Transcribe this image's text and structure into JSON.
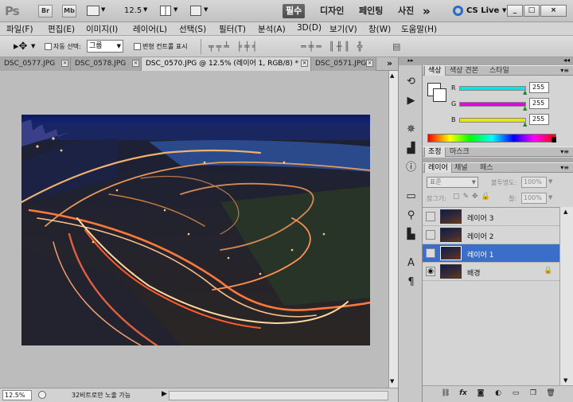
{
  "app": {
    "logo": "Ps"
  },
  "title_bar": {
    "br_label": "Br",
    "mb_label": "Mb",
    "zoom": "12.5",
    "workspaces": [
      "필수",
      "디자인",
      "페인팅",
      "사진"
    ],
    "overflow": "»",
    "cslive": "CS Live",
    "window_buttons": [
      "_",
      "□",
      "×"
    ]
  },
  "menu": [
    "파일(F)",
    "편집(E)",
    "이미지(I)",
    "레이어(L)",
    "선택(S)",
    "필터(T)",
    "분석(A)",
    "3D(D)",
    "보기(V)",
    "창(W)",
    "도움말(H)"
  ],
  "options_bar": {
    "auto_select_label": "자동 선택:",
    "auto_select_value": "그룹",
    "transform_label": "변형 컨트롤 표시"
  },
  "tabs": [
    {
      "label": "DSC_0577.JPG",
      "active": false
    },
    {
      "label": "DSC_0578.JPG",
      "active": false
    },
    {
      "label": "DSC_0570.JPG @ 12.5% (레이어 1, RGB/8) *",
      "active": true
    },
    {
      "label": "DSC_0571.JPG",
      "active": false
    }
  ],
  "tab_overflow": "»",
  "status": {
    "zoom": "12.5%",
    "info": "32비트로만 노출 가능"
  },
  "color_panel": {
    "tabs": [
      "색상",
      "색상 견본",
      "스타일"
    ],
    "channels": [
      {
        "label": "R",
        "value": "255",
        "color": "#00e5e5"
      },
      {
        "label": "G",
        "value": "255",
        "color": "#e500e5"
      },
      {
        "label": "B",
        "value": "255",
        "color": "#e5e500"
      }
    ]
  },
  "adjust_panel": {
    "tabs": [
      "조정",
      "마스크"
    ]
  },
  "layers_panel": {
    "tabs": [
      "레이어",
      "채널",
      "패스"
    ],
    "blend_mode": "표준",
    "opacity_label": "불투명도:",
    "opacity_value": "100%",
    "lock_label": "잠그기:",
    "fill_label": "칠:",
    "fill_value": "100%",
    "layers": [
      {
        "name": "레이어 3",
        "visible": false,
        "selected": false,
        "locked": false
      },
      {
        "name": "레이어 2",
        "visible": false,
        "selected": false,
        "locked": false
      },
      {
        "name": "레이어 1",
        "visible": false,
        "selected": true,
        "locked": false
      },
      {
        "name": "배경",
        "visible": true,
        "selected": false,
        "locked": true
      }
    ],
    "footer_icons": [
      "link-icon",
      "fx-icon",
      "mask-icon",
      "adjustment-icon",
      "group-icon",
      "new-layer-icon",
      "trash-icon"
    ]
  }
}
